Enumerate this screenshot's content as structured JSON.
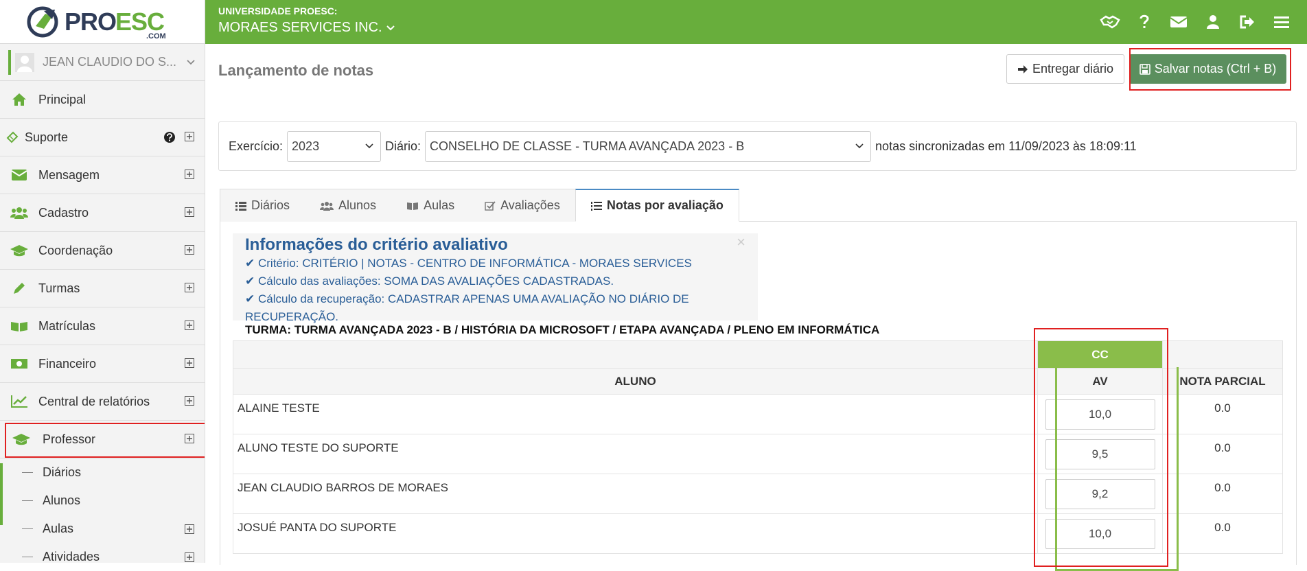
{
  "header": {
    "logo_text": "PROESC.com",
    "org_small": "UNIVERSIDADE PROESC:",
    "org_big": "MORAES SERVICES INC.",
    "icons": [
      "handshake-icon",
      "question-icon",
      "envelope-icon",
      "user-icon",
      "sign-out-icon",
      "bars-icon"
    ]
  },
  "sidebar": {
    "user_name": "JEAN CLAUDIO DO S...",
    "items": [
      {
        "label": "Principal",
        "icon": "home-icon"
      },
      {
        "label": "Suporte",
        "icon": "ticket-icon"
      },
      {
        "label": "Mensagem",
        "icon": "envelope-icon"
      },
      {
        "label": "Cadastro",
        "icon": "users-icon"
      },
      {
        "label": "Coordenação",
        "icon": "graduation-cap-icon"
      },
      {
        "label": "Turmas",
        "icon": "pencil-icon"
      },
      {
        "label": "Matrículas",
        "icon": "book-icon"
      },
      {
        "label": "Financeiro",
        "icon": "money-icon"
      },
      {
        "label": "Central de relatórios",
        "icon": "line-chart-icon"
      },
      {
        "label": "Professor",
        "icon": "graduation-cap-icon"
      }
    ],
    "sub_items": [
      {
        "label": "Diários"
      },
      {
        "label": "Alunos"
      },
      {
        "label": "Aulas"
      },
      {
        "label": "Atividades"
      }
    ],
    "accent": "#68ae3c"
  },
  "main": {
    "title": "Lançamento de notas",
    "btn_entregar": "Entregar diário",
    "btn_salvar": "Salvar notas (Ctrl + B)",
    "filter": {
      "exercicio_label": "Exercício:",
      "exercicio_value": "2023",
      "diario_label": "Diário:",
      "diario_value": "CONSELHO DE CLASSE - TURMA AVANÇADA 2023 - B",
      "sync_text": "notas sincronizadas em 11/09/2023 às 18:09:11"
    },
    "tabs": [
      {
        "label": "Diários",
        "icon": "list-icon"
      },
      {
        "label": "Alunos",
        "icon": "users-icon"
      },
      {
        "label": "Aulas",
        "icon": "book-icon"
      },
      {
        "label": "Avaliações",
        "icon": "check-square-icon"
      },
      {
        "label": "Notas por avaliação",
        "icon": "list-ol-icon"
      }
    ],
    "info": {
      "title": "Informações do critério avaliativo",
      "close": "×",
      "lines": [
        "Critério: CRITÉRIO | NOTAS - CENTRO DE INFORMÁTICA - MORAES SERVICES",
        "Cálculo das avaliações: SOMA DAS AVALIAÇÕES CADASTRADAS.",
        "Cálculo da recuperação: CADASTRAR APENAS UMA AVALIAÇÃO NO DIÁRIO DE RECUPERAÇÃO."
      ]
    },
    "turma": "TURMA: TURMA AVANÇADA 2023 - B / HISTÓRIA DA MICROSOFT / ETAPA AVANÇADA / PLENO EM INFORMÁTICA",
    "table": {
      "group_header": "CC",
      "col_aluno": "ALUNO",
      "col_av": "AV",
      "col_parcial": "NOTA PARCIAL",
      "rows": [
        {
          "name": "ALAINE TESTE",
          "av": "10,0",
          "parcial": "0.0"
        },
        {
          "name": "ALUNO TESTE DO SUPORTE",
          "av": "9,5",
          "parcial": "0.0"
        },
        {
          "name": "JEAN CLAUDIO BARROS DE MORAES",
          "av": "9,2",
          "parcial": "0.0"
        },
        {
          "name": "JOSUÉ PANTA DO SUPORTE",
          "av": "10,0",
          "parcial": "0.0"
        }
      ]
    },
    "colors": {
      "primary": "#68ae3c",
      "cc_header": "#8abd4a",
      "save_button": "#5b8f5e",
      "info_text": "#2a5e97",
      "highlight": "#e02020"
    }
  }
}
